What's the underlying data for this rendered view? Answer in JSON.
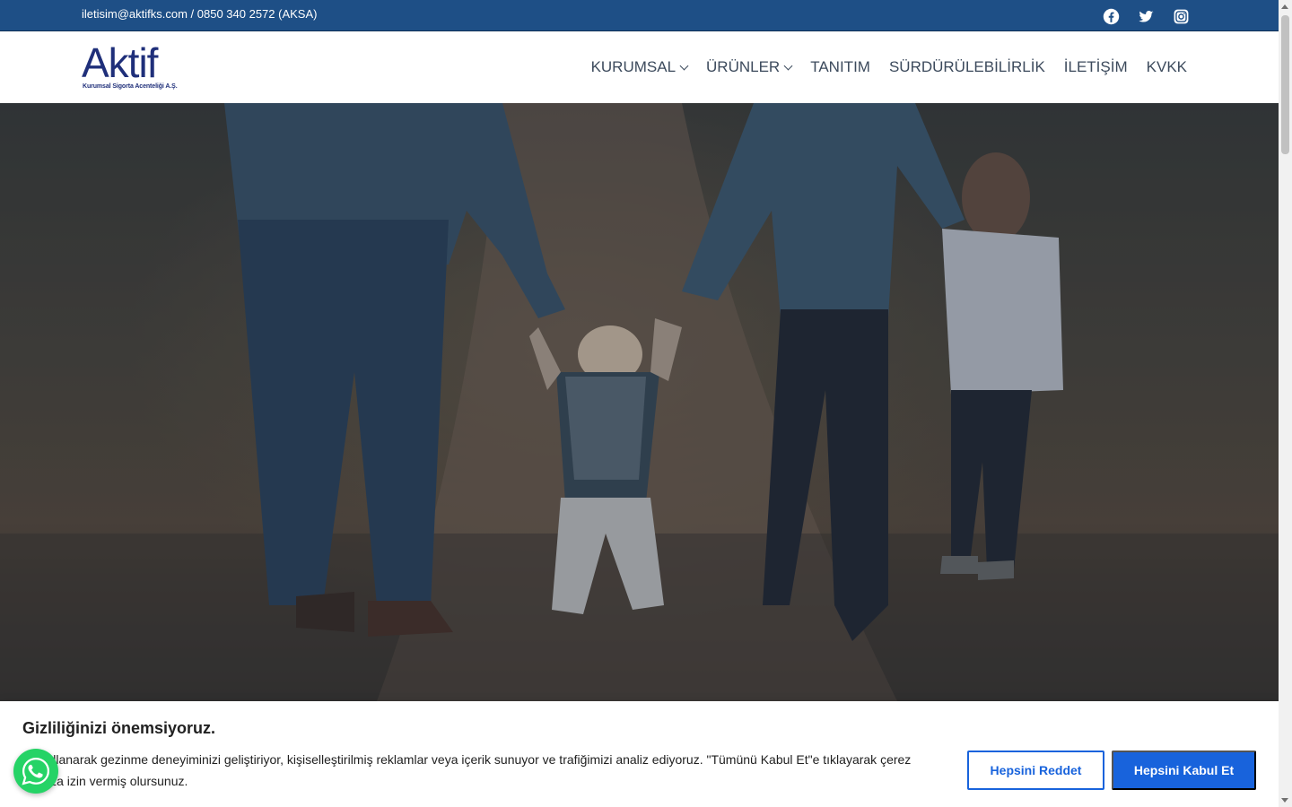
{
  "topbar": {
    "contact": "iletisim@aktifks.com / 0850 340 2572 (AKSA)",
    "social": [
      {
        "icon": "facebook-icon"
      },
      {
        "icon": "twitter-icon"
      },
      {
        "icon": "instagram-icon"
      }
    ],
    "bg_color": "#1e4f86"
  },
  "header": {
    "logo_word": "Aktif",
    "logo_tagline": "Kurumsal Sigorta Acenteliği A.Ş.",
    "nav": [
      {
        "label": "KURUMSAL",
        "dropdown": true
      },
      {
        "label": "ÜRÜNLER",
        "dropdown": true
      },
      {
        "label": "TANITIM",
        "dropdown": false
      },
      {
        "label": "SÜRDÜRÜLEBİLİRLİK",
        "dropdown": false
      },
      {
        "label": "İLETİŞİM",
        "dropdown": false
      },
      {
        "label": "KVKK",
        "dropdown": false
      }
    ]
  },
  "cookie_banner": {
    "title": "Gizliliğinizi önemsiyoruz.",
    "text": "eri kullanarak gezinme deneyiminizi geliştiriyor, kişiselleştirilmiş reklamlar veya içerik sunuyor ve trafiğimizi analiz ediyoruz. \"Tümünü Kabul Et\"e tıklayarak çerez mımıza izin vermiş olursunuz.",
    "reject_label": "Hepsini Reddet",
    "accept_label": "Hepsini Kabul Et",
    "accent_color": "#1863dc"
  },
  "widgets": {
    "whatsapp_icon": "whatsapp-icon",
    "whatsapp_color": "#25d366"
  }
}
